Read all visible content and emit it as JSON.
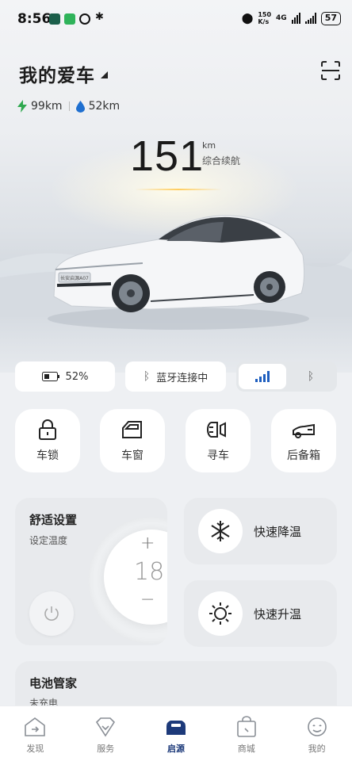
{
  "status_bar": {
    "time": "8:56",
    "net_speed_value": "150",
    "net_speed_unit": "K/s",
    "network": "4G",
    "battery": "57"
  },
  "header": {
    "title": "我的爱车",
    "scan_icon": "scan-icon"
  },
  "ranges": {
    "electric": "99km",
    "fuel": "52km"
  },
  "total_range": {
    "value": "151",
    "unit": "km",
    "label": "综合续航"
  },
  "car_badge": "长安启源A07",
  "chips": {
    "battery_percent": "52%",
    "bluetooth_status": "蓝牙连接中"
  },
  "controls": [
    {
      "label": "车锁",
      "icon": "lock-icon"
    },
    {
      "label": "车窗",
      "icon": "car-window-icon"
    },
    {
      "label": "寻车",
      "icon": "find-car-icon"
    },
    {
      "label": "后备箱",
      "icon": "trunk-icon"
    }
  ],
  "comfort": {
    "title": "舒适设置",
    "subtitle": "设定温度",
    "plus": "+",
    "temperature": "18",
    "minus": "−"
  },
  "quick": {
    "cool_label": "快速降温",
    "heat_label": "快速升温"
  },
  "battery_manager": {
    "title": "电池管家",
    "status": "未充电"
  },
  "nav": [
    {
      "label": "发现",
      "icon": "discover-icon",
      "active": false
    },
    {
      "label": "服务",
      "icon": "service-icon",
      "active": false
    },
    {
      "label": "启源",
      "icon": "car-icon",
      "active": true
    },
    {
      "label": "商城",
      "icon": "mall-icon",
      "active": false
    },
    {
      "label": "我的",
      "icon": "profile-icon",
      "active": false
    }
  ],
  "colors": {
    "accent": "#1d3a7a",
    "electric": "#2fa84f",
    "fuel": "#1f6fd0"
  }
}
